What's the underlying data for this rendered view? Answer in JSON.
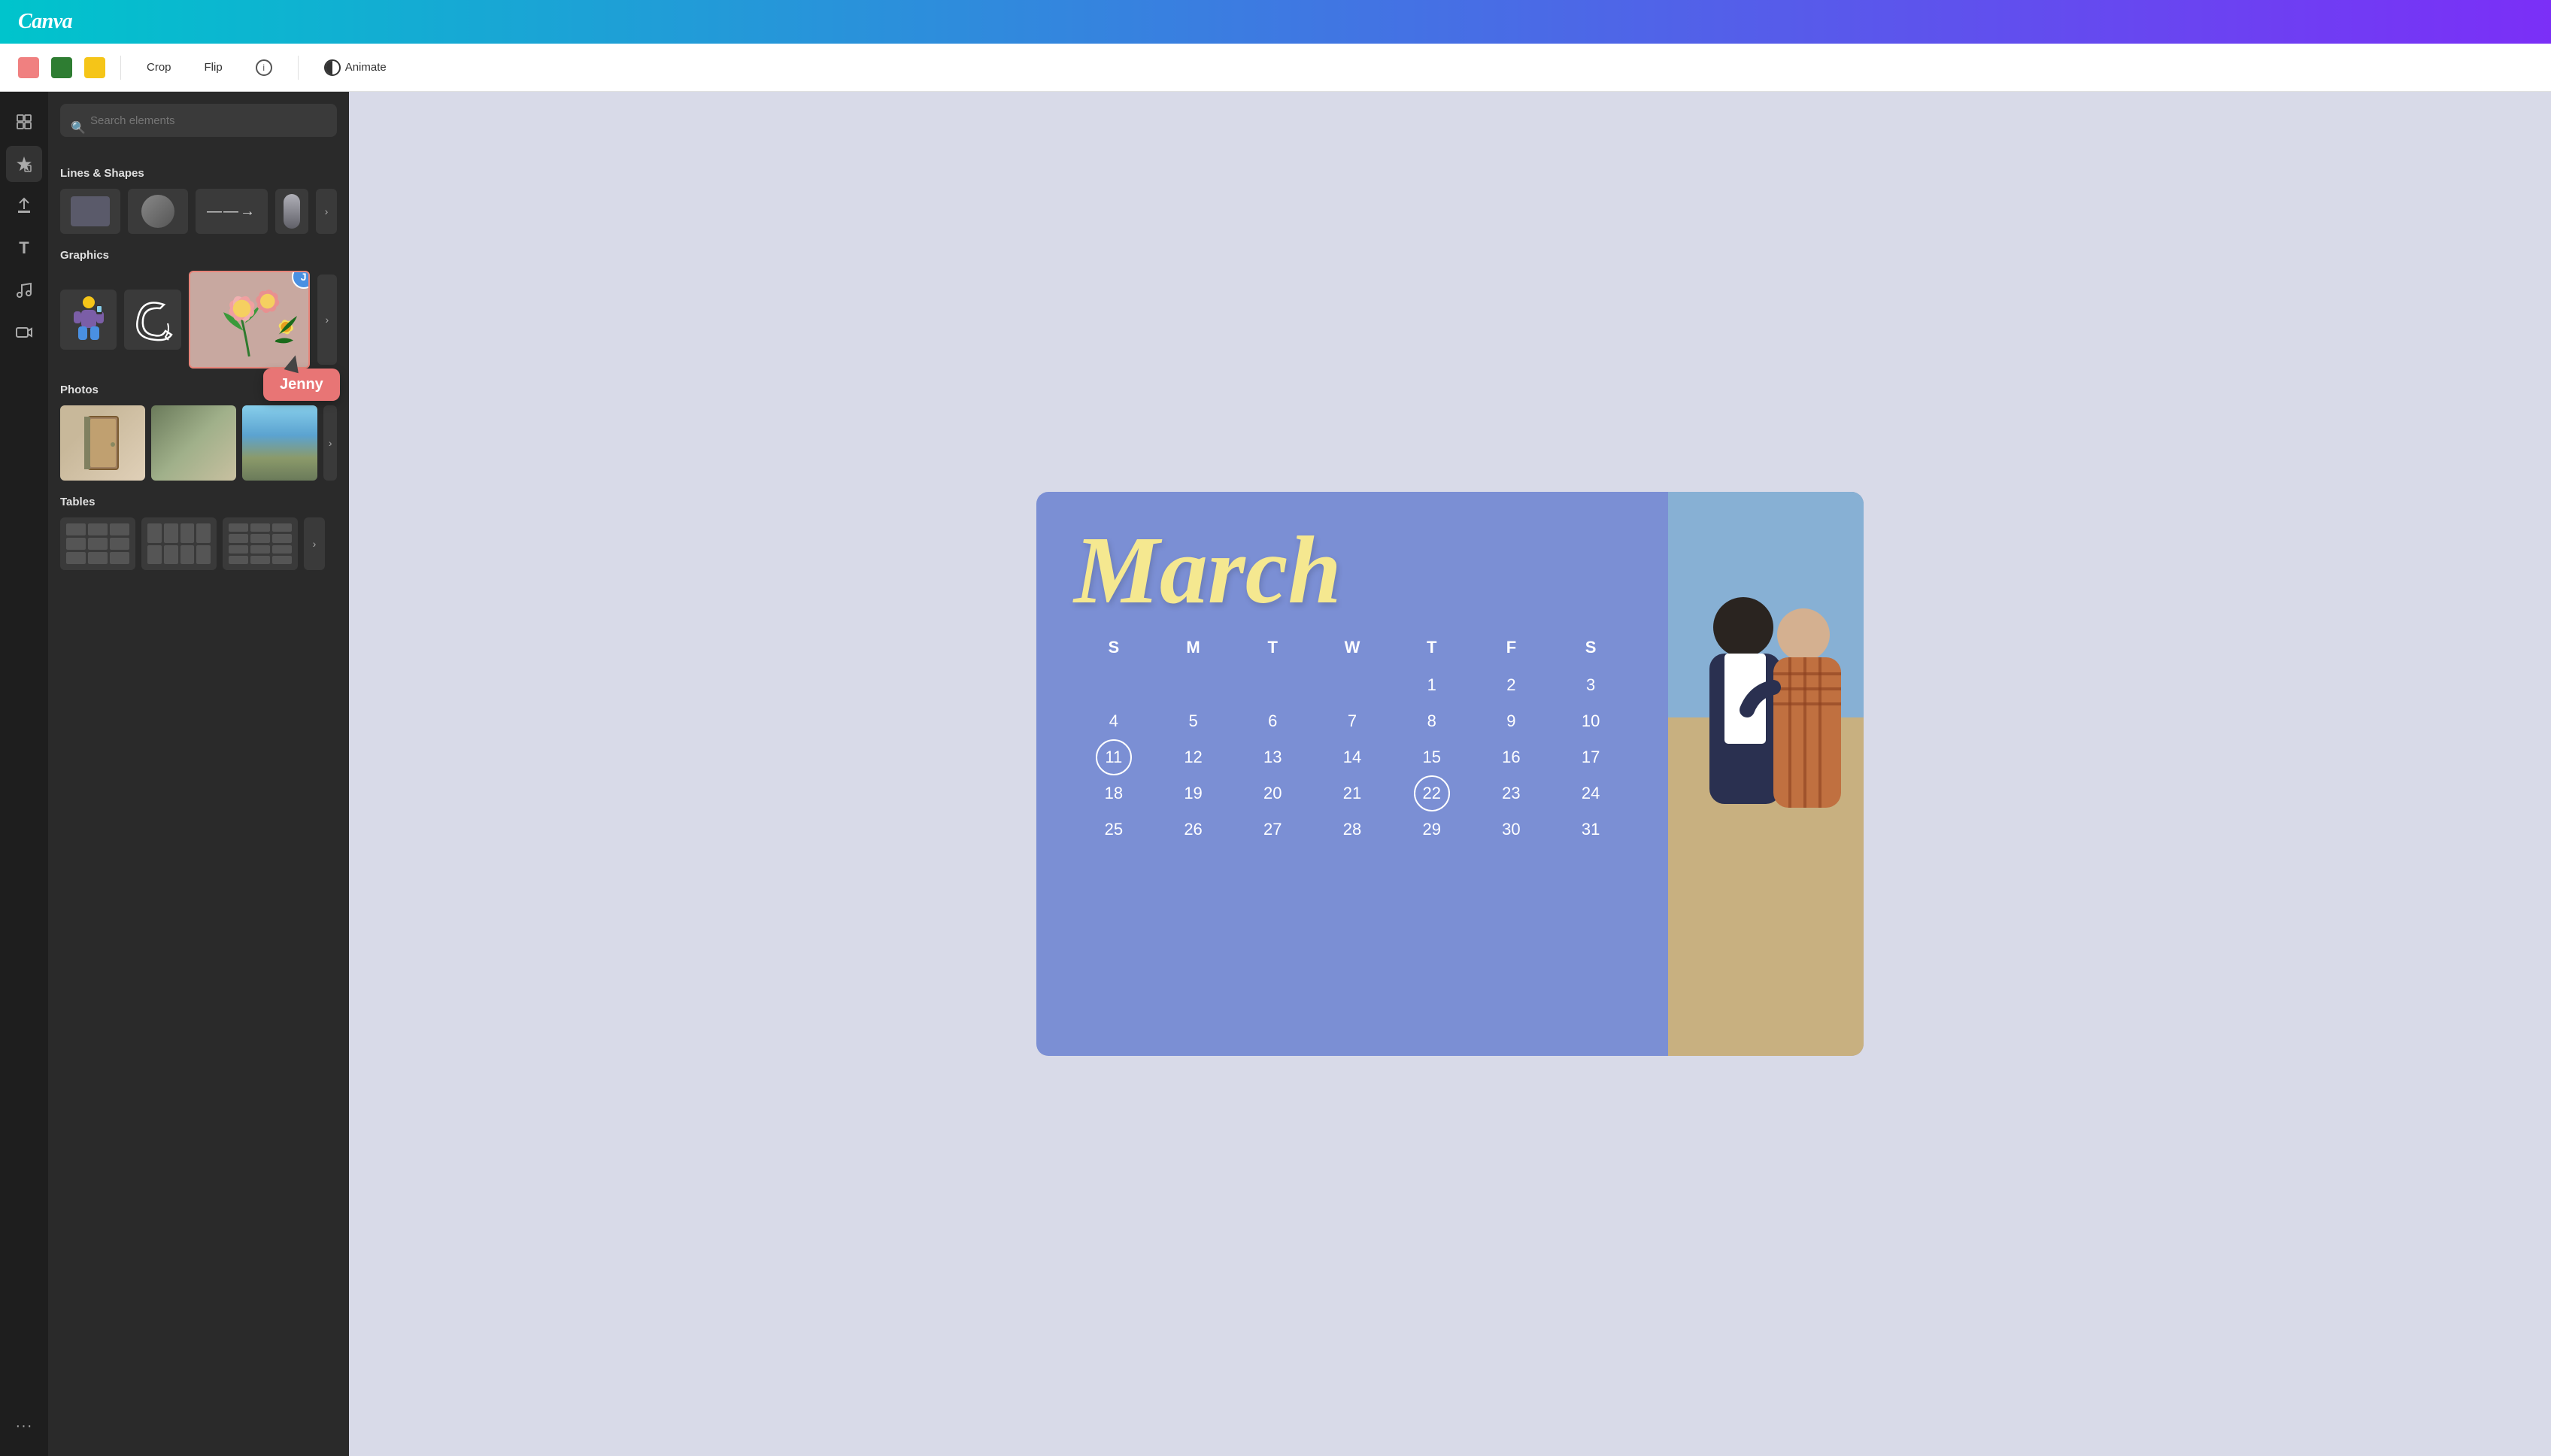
{
  "header": {
    "logo": "Canva",
    "gradient_start": "#00c4cc",
    "gradient_end": "#7b2ff7"
  },
  "toolbar": {
    "swatches": [
      {
        "color": "#f08080",
        "label": "pink-swatch"
      },
      {
        "color": "#2e7d32",
        "label": "green-swatch"
      },
      {
        "color": "#f5c518",
        "label": "yellow-swatch"
      }
    ],
    "crop_label": "Crop",
    "flip_label": "Flip",
    "info_label": "ⓘ",
    "animate_label": "Animate"
  },
  "sidebar": {
    "icons": [
      {
        "name": "layout-icon",
        "symbol": "⊞",
        "label": "Layout"
      },
      {
        "name": "elements-icon",
        "symbol": "❤◆",
        "label": "Elements"
      },
      {
        "name": "upload-icon",
        "symbol": "↑",
        "label": "Uploads"
      },
      {
        "name": "text-icon",
        "symbol": "T",
        "label": "Text"
      },
      {
        "name": "music-icon",
        "symbol": "♪",
        "label": "Music"
      },
      {
        "name": "video-icon",
        "symbol": "▶",
        "label": "Video"
      },
      {
        "name": "more-icon",
        "symbol": "…",
        "label": "More"
      }
    ]
  },
  "elements_panel": {
    "search_placeholder": "Search elements",
    "sections": {
      "shapes": {
        "title": "Lines & Shapes"
      },
      "graphics": {
        "title": "Graphics"
      },
      "photos": {
        "title": "Photos"
      },
      "tables": {
        "title": "Tables"
      }
    }
  },
  "calendar": {
    "month": "March",
    "day_headers": [
      "S",
      "M",
      "T",
      "W",
      "T",
      "F",
      "S"
    ],
    "rows": [
      [
        " ",
        " ",
        " ",
        " ",
        "1",
        "2",
        "3"
      ],
      [
        "4",
        "5",
        "6",
        "7",
        "8",
        "9",
        "10"
      ],
      [
        "11",
        "12",
        "13",
        "14",
        "15",
        "16",
        "17"
      ],
      [
        "18",
        "19",
        "20",
        "21",
        "22",
        "23",
        "24"
      ],
      [
        "25",
        "26",
        "27",
        "28",
        "29",
        "30",
        "31"
      ]
    ],
    "circled_dates": [
      "22"
    ],
    "highlighted_dates": [
      "11"
    ],
    "colors": {
      "bg": "#7b8fd4",
      "month_text": "#f5e890",
      "day_text": "white"
    }
  },
  "cursor": {
    "label": "Jenny",
    "avatar_initial": "J",
    "label_color": "#e87575"
  }
}
